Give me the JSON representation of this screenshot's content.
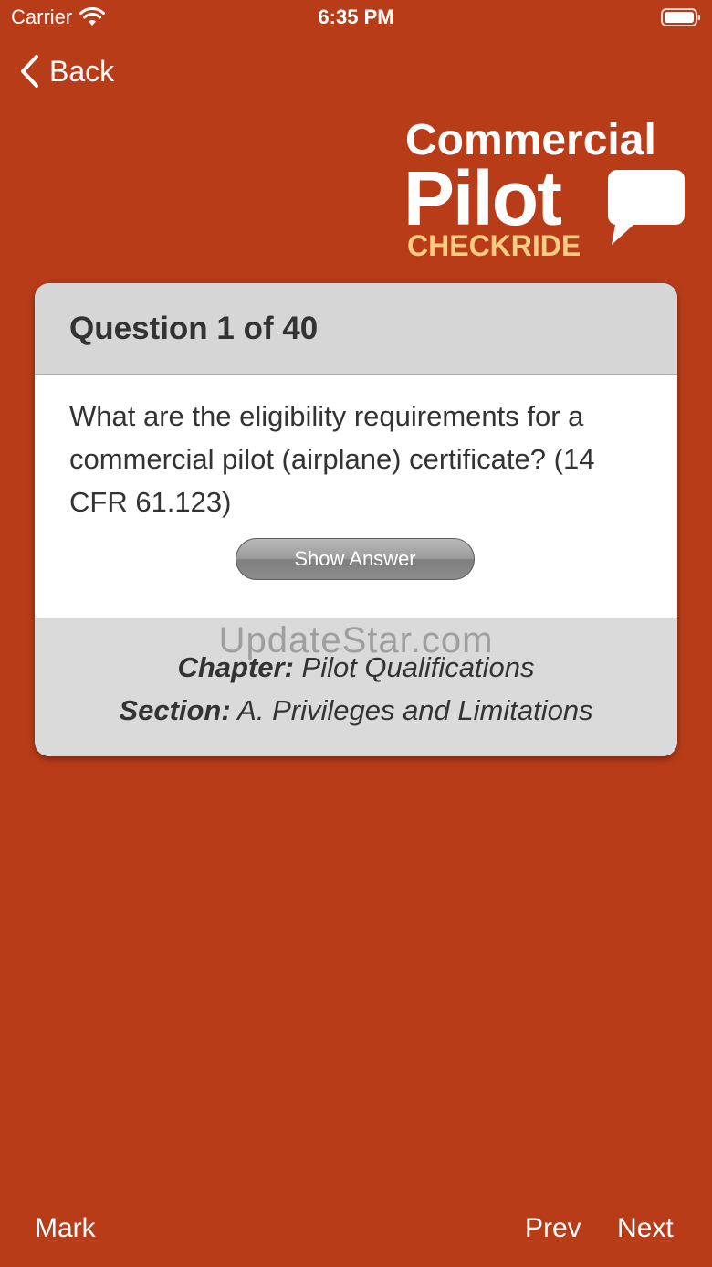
{
  "status_bar": {
    "carrier": "Carrier",
    "time": "6:35 PM",
    "icons": [
      "wifi-icon",
      "battery-icon"
    ]
  },
  "nav": {
    "back_label": "Back",
    "back_icon": "chevron-left-icon"
  },
  "logo": {
    "line1": "Commercial",
    "line2": "Pilot",
    "line3": "CHECKRIDE",
    "icon": "speech-bubble-icon",
    "accent_color": "#F6CD83"
  },
  "card": {
    "title": "Question 1 of 40",
    "question": "What are the eligibility requirements for a commercial pilot (airplane) certificate? (14 CFR 61.123)",
    "show_answer_label": "Show Answer",
    "watermark": "UpdateStar.com",
    "chapter_label": "Chapter:",
    "chapter_value": " Pilot Qualifications",
    "section_label": "Section:",
    "section_value": " A. Privileges and Limitations"
  },
  "toolbar": {
    "mark_label": "Mark",
    "prev_label": "Prev",
    "next_label": "Next"
  },
  "colors": {
    "background": "#B93C19",
    "card": "#DADADA",
    "text": "#333333"
  }
}
